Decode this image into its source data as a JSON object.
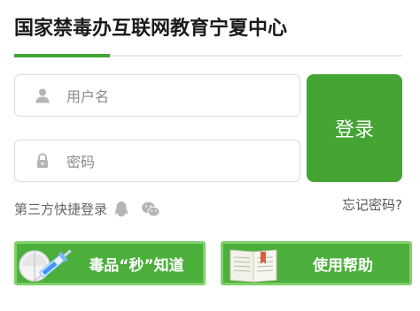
{
  "title": "国家禁毒办互联网教育宁夏中心",
  "login": {
    "username_placeholder": "用户名",
    "password_placeholder": "密码",
    "submit_label": "登录",
    "third_party_label": "第三方快捷登录",
    "forgot_label": "忘记密码?"
  },
  "promos": [
    {
      "label": "毒品“秒”知道",
      "icon": "pill-syringe-icon"
    },
    {
      "label": "使用帮助",
      "icon": "open-book-icon"
    }
  ],
  "colors": {
    "accent": "#44a535",
    "accent_light": "#7fd06b",
    "icon_gray": "#b5b5b5"
  }
}
